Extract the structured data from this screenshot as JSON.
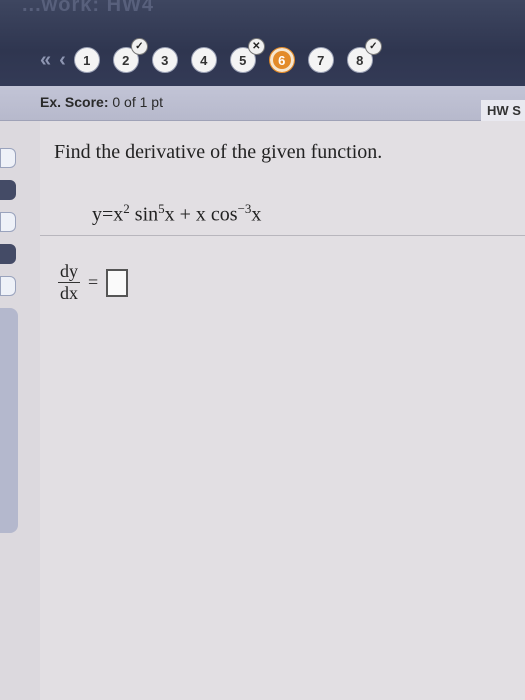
{
  "header": {
    "faded_title": "...work: HW4"
  },
  "nav": {
    "first_icon": "double-chevron-left-icon",
    "prev_icon": "chevron-left-icon",
    "questions": [
      {
        "label": "1",
        "status": "none"
      },
      {
        "label": "2",
        "status": "correct"
      },
      {
        "label": "3",
        "status": "none"
      },
      {
        "label": "4",
        "status": "none"
      },
      {
        "label": "5",
        "status": "incorrect"
      },
      {
        "label": "6",
        "status": "current"
      },
      {
        "label": "7",
        "status": "none"
      },
      {
        "label": "8",
        "status": "correct"
      }
    ]
  },
  "score": {
    "label": "Ex. Score:",
    "value": "0 of 1 pt"
  },
  "hw_label": "HW S",
  "question": {
    "text": "Find the derivative of the given function.",
    "eq_y": "y",
    "eq_eq": "=",
    "term1_base": "x",
    "term1_exp": "2",
    "term1_fn": "sin",
    "term1_fn_exp": "5",
    "term1_arg": "x",
    "plus": "+",
    "term2_var": "x",
    "term2_fn": "cos",
    "term2_fn_exp": "−3",
    "term2_arg": "x"
  },
  "answer": {
    "numerator": "dy",
    "denominator": "dx",
    "equals": "="
  },
  "colors": {
    "current_question": "#e38b2a",
    "topbar": "#2f3650"
  }
}
